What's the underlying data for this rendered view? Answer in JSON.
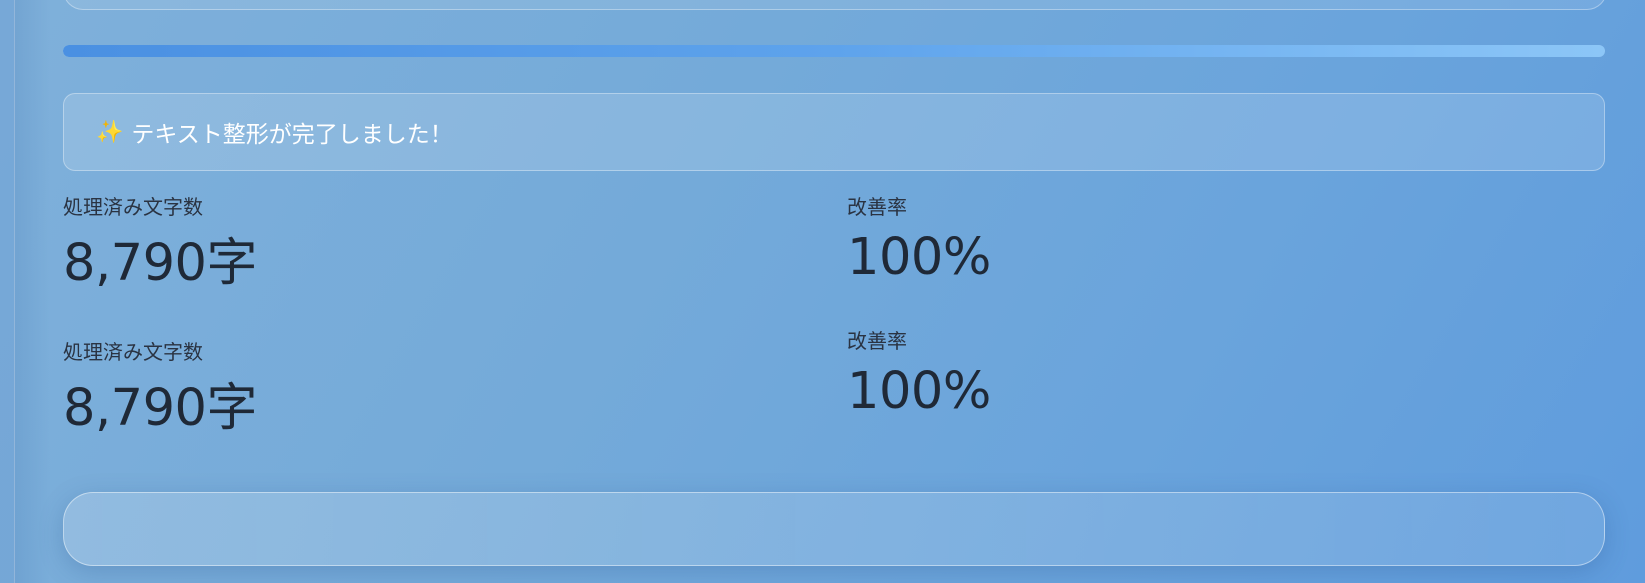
{
  "progress": {
    "value_percent": 100,
    "colors": [
      "#4a90e2",
      "#8cc6f7"
    ]
  },
  "alert": {
    "icon": "sparkles-icon",
    "icon_glyph": "✨",
    "message": "テキスト整形が完了しました！"
  },
  "metrics": [
    {
      "label": "処理済み文字数",
      "value": "8,790字"
    },
    {
      "label": "改善率",
      "value": "100%"
    },
    {
      "label": "処理済み文字数",
      "value": "8,790字"
    },
    {
      "label": "改善率",
      "value": "100%"
    }
  ]
}
